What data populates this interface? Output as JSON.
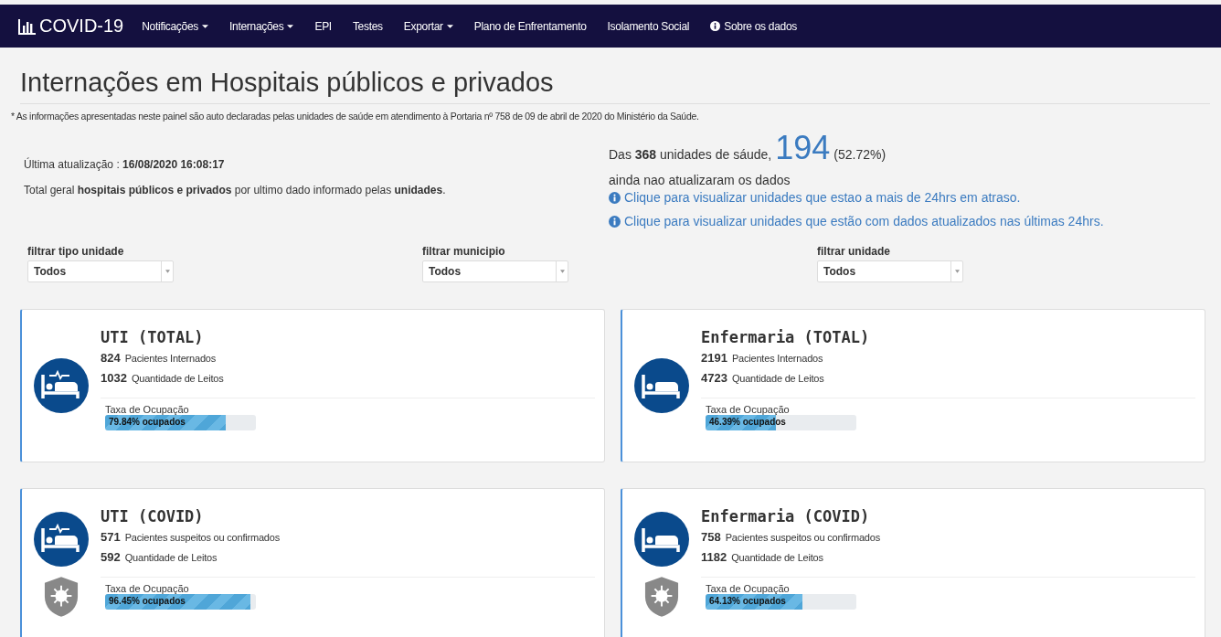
{
  "navbar": {
    "brand": "COVID-19",
    "items": [
      {
        "label": "Notificações",
        "dropdown": true,
        "info_icon": false
      },
      {
        "label": "Internações",
        "dropdown": true,
        "info_icon": false
      },
      {
        "label": "EPI",
        "dropdown": false,
        "info_icon": false
      },
      {
        "label": "Testes",
        "dropdown": false,
        "info_icon": false
      },
      {
        "label": "Exportar",
        "dropdown": true,
        "info_icon": false
      },
      {
        "label": "Plano de Enfrentamento",
        "dropdown": false,
        "info_icon": false
      },
      {
        "label": "Isolamento Social",
        "dropdown": false,
        "info_icon": false
      },
      {
        "label": "Sobre os dados",
        "dropdown": false,
        "info_icon": true
      }
    ]
  },
  "page_title": "Internações em Hospitais públicos e privados",
  "disclaimer": "* As informações apresentadas neste painel são auto declaradas pelas unidades de saúde em atendimento à Portaria nº 758 de 09 de abril de 2020 do Ministério da Saúde.",
  "summary": {
    "last_update": "Última atualização : **16/08/2020 16:08:17**",
    "total_note": "Total geral **hospitais públicos e privados** por ultimo dado informado pelas **unidades**."
  },
  "outdated": {
    "intro": "Das **368** unidades de sáude,",
    "count": "194",
    "percent": "(52.72%)",
    "text": "ainda nao atualizaram os dados",
    "links": [
      "Clique para visualizar unidades que estao a mais de 24hrs em atraso.",
      "Clique para visualizar unidades que estão com dados atualizados nas últimas 24hrs."
    ]
  },
  "filters": [
    {
      "label": "filtrar tipo unidade",
      "value": "Todos"
    },
    {
      "label": "filtrar municipio",
      "value": "Todos"
    },
    {
      "label": "filtrar unidade",
      "value": "Todos"
    }
  ],
  "cards": [
    {
      "title": "UTI (TOTAL)",
      "kind": "icu",
      "covid": false,
      "stats": [
        {
          "value": "824",
          "label": "Pacientes Internados"
        },
        {
          "value": "1032",
          "label": "Quantidade de Leitos"
        }
      ],
      "rate_label": "Taxa de Ocupação",
      "level": 0.7984,
      "rate": "79.84% ocupados"
    },
    {
      "title": "Enfermaria (TOTAL)",
      "kind": "ward",
      "covid": false,
      "stats": [
        {
          "value": "2191",
          "label": "Pacientes Internados"
        },
        {
          "value": "4723",
          "label": "Quantidade de Leitos"
        }
      ],
      "rate_label": "Taxa de Ocupação",
      "level": 0.4639,
      "rate": "46.39% ocupados"
    },
    {
      "title": "UTI (COVID)",
      "kind": "icu",
      "covid": true,
      "stats": [
        {
          "value": "571",
          "label": "Pacientes suspeitos ou confirmados"
        },
        {
          "value": "592",
          "label": "Quantidade de Leitos"
        }
      ],
      "rate_label": "Taxa de Ocupação",
      "level": 0.9645,
      "rate": "96.45% ocupados"
    },
    {
      "title": "Enfermaria (COVID)",
      "kind": "ward",
      "covid": true,
      "stats": [
        {
          "value": "758",
          "label": "Pacientes suspeitos ou confirmados"
        },
        {
          "value": "1182",
          "label": "Quantidade de Leitos"
        }
      ],
      "rate_label": "Taxa de Ocupação",
      "level": 0.6413,
      "rate": "64.13% ocupados"
    }
  ]
}
